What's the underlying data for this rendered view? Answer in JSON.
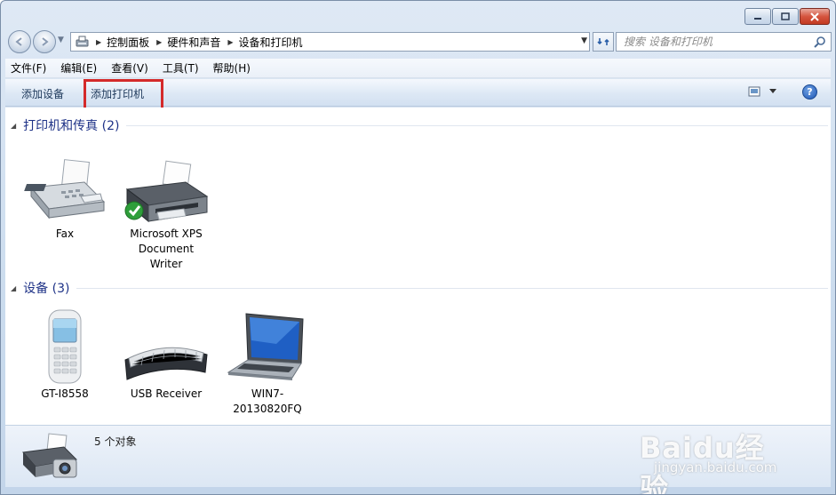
{
  "breadcrumb": {
    "items": [
      "控制面板",
      "硬件和声音",
      "设备和打印机"
    ]
  },
  "search": {
    "placeholder": "搜索 设备和打印机"
  },
  "menu": {
    "items": [
      "文件(F)",
      "编辑(E)",
      "查看(V)",
      "工具(T)",
      "帮助(H)"
    ]
  },
  "commands": {
    "add_device": "添加设备",
    "add_printer": "添加打印机",
    "help": "?"
  },
  "groups": {
    "printers": {
      "title": "打印机和传真 (2)",
      "items": [
        {
          "label": "Fax",
          "icon": "fax-icon"
        },
        {
          "label": "Microsoft XPS Document Writer",
          "icon": "printer-icon"
        }
      ]
    },
    "devices": {
      "title": "设备 (3)",
      "items": [
        {
          "label": "GT-I8558",
          "icon": "phone-icon"
        },
        {
          "label": "USB Receiver",
          "icon": "keyboard-icon"
        },
        {
          "label": "WIN7-20130820FQ",
          "icon": "laptop-icon"
        }
      ]
    }
  },
  "details": {
    "summary": "5 个对象"
  },
  "watermark": {
    "brand": "Baidu经验",
    "site": "jingyan.baidu.com"
  },
  "colors": {
    "accent": "#1e3287",
    "highlight": "#d42a2a"
  }
}
